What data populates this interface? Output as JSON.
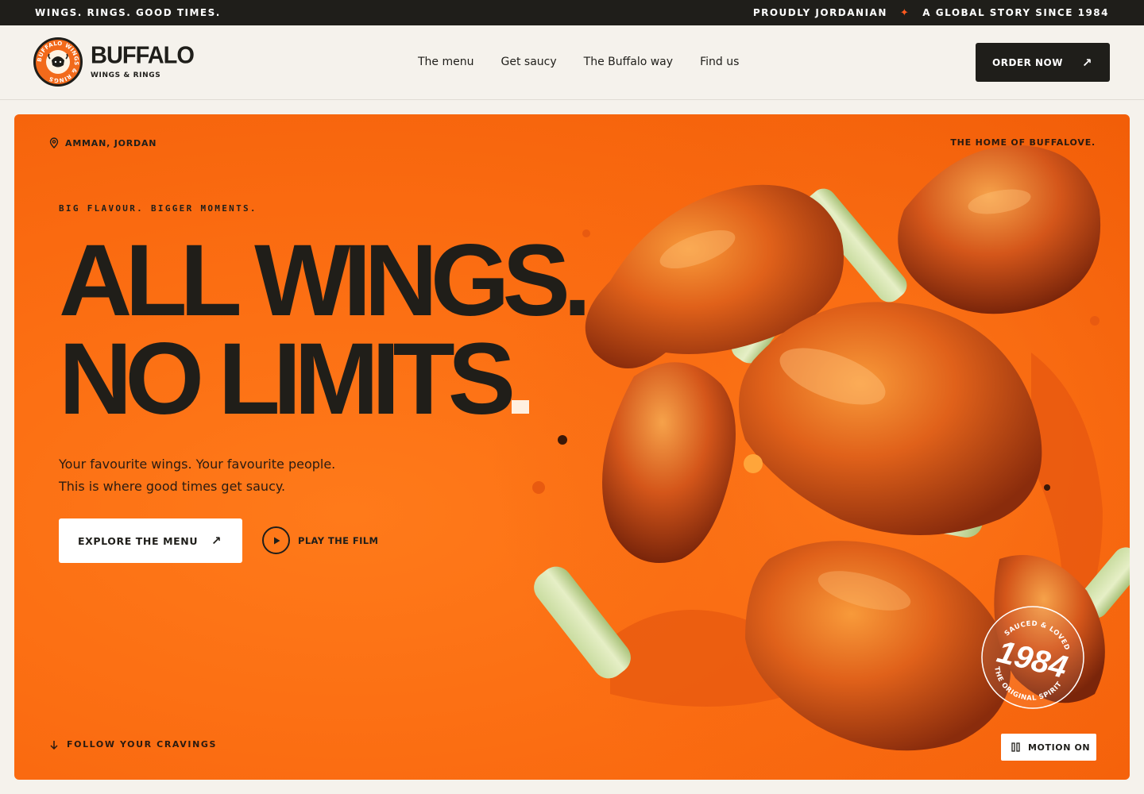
{
  "topbar": {
    "left_text": "WINGS. RINGS. GOOD TIMES.",
    "right_primary": "PROUDLY JORDANIAN",
    "right_secondary": "A GLOBAL STORY SINCE 1984",
    "separator_icon": "sparkle-icon"
  },
  "logo": {
    "brand": "BUFFALO",
    "sub": "WINGS & RINGS",
    "badge_text": "BUFFALO WINGS & RINGS"
  },
  "nav": {
    "items": [
      {
        "label": "The menu"
      },
      {
        "label": "Get saucy"
      },
      {
        "label": "The Buffalo way"
      },
      {
        "label": "Find us"
      }
    ]
  },
  "header": {
    "order_label": "ORDER NOW"
  },
  "hero": {
    "location": "AMMAN, JORDAN",
    "tagline_right": "THE HOME OF BUFFALOVE.",
    "kicker": "BIG FLAVOUR. BIGGER MOMENTS.",
    "headline_line1": "ALL WINGS.",
    "headline_line2": "NO LIMITS",
    "lede_line1": "Your favourite wings. Your favourite people.",
    "lede_line2": "This is where good times get saucy.",
    "explore_label": "EXPLORE THE MENU",
    "play_label": "PLAY THE FILM",
    "follow_label": "FOLLOW YOUR CRAVINGS",
    "motion_label": "MOTION ON",
    "seal": {
      "top": "SAUCED & LOVED",
      "year": "1984",
      "bottom": "THE ORIGINAL SPIRIT"
    }
  },
  "colors": {
    "accent": "#ff5a1f",
    "hero_orange": "#fa6a10",
    "ink": "#1f1e1a",
    "paper": "#f5f2ec"
  }
}
